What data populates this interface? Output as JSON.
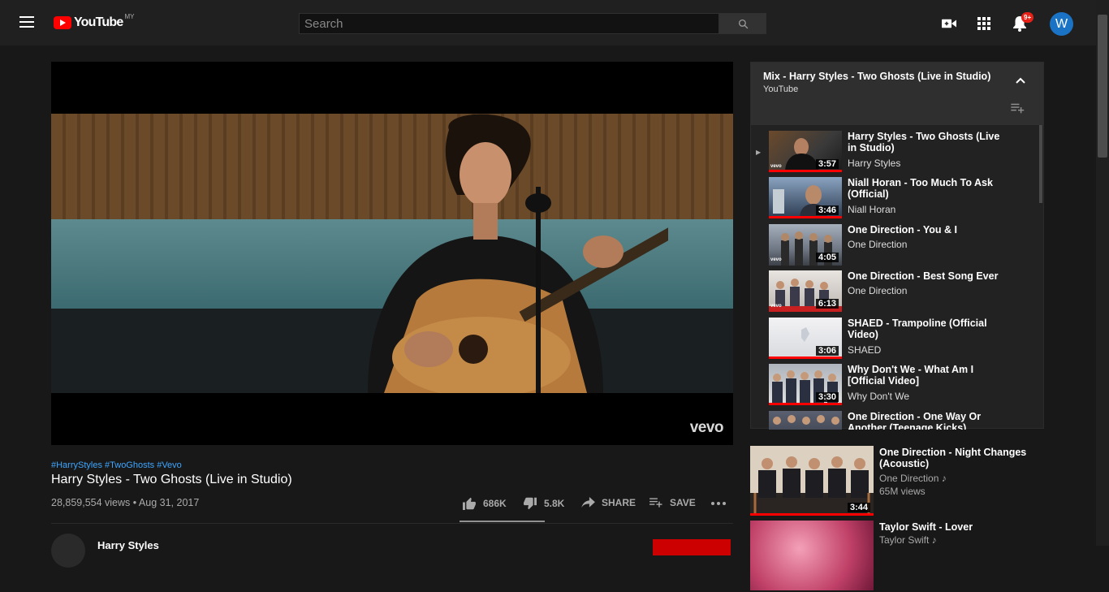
{
  "header": {
    "logo_text": "YouTube",
    "country_code": "MY",
    "search_placeholder": "Search",
    "notification_badge": "9+",
    "avatar_letter": "W"
  },
  "video": {
    "hashtags": "#HarryStyles #TwoGhosts #Vevo",
    "title": "Harry Styles - Two Ghosts (Live in Studio)",
    "views_date": "28,859,554 views • Aug 31, 2017",
    "watermark": "vevo",
    "likes": "686K",
    "dislikes": "5.8K",
    "share_label": "SHARE",
    "save_label": "SAVE",
    "channel_name": "Harry Styles"
  },
  "playlist": {
    "title": "Mix - Harry Styles - Two Ghosts (Live in Studio)",
    "subtitle": "YouTube",
    "items": [
      {
        "title": "Harry Styles - Two Ghosts (Live in Studio)",
        "channel": "Harry Styles",
        "duration": "3:57",
        "current": true
      },
      {
        "title": "Niall Horan - Too Much To Ask (Official)",
        "channel": "Niall Horan",
        "duration": "3:46"
      },
      {
        "title": "One Direction - You & I",
        "channel": "One Direction",
        "duration": "4:05"
      },
      {
        "title": "One Direction - Best Song Ever",
        "channel": "One Direction",
        "duration": "6:13"
      },
      {
        "title": "SHAED - Trampoline (Official Video)",
        "channel": "SHAED",
        "duration": "3:06"
      },
      {
        "title": "Why Don't We - What Am I [Official Video]",
        "channel": "Why Don't We",
        "duration": "3:30"
      },
      {
        "title": "One Direction - One Way Or Another (Teenage Kicks)",
        "channel": "One Direction",
        "duration": ""
      }
    ]
  },
  "recommendations": [
    {
      "title": "One Direction - Night Changes (Acoustic)",
      "channel": "One Direction ♪",
      "views": "65M views",
      "duration": "3:44"
    },
    {
      "title": "Taylor Swift - Lover",
      "channel": "Taylor Swift ♪",
      "views": "",
      "duration": ""
    }
  ],
  "colors": {
    "accent": "#ff0000",
    "link": "#3ea6ff",
    "bg": "#181818"
  }
}
